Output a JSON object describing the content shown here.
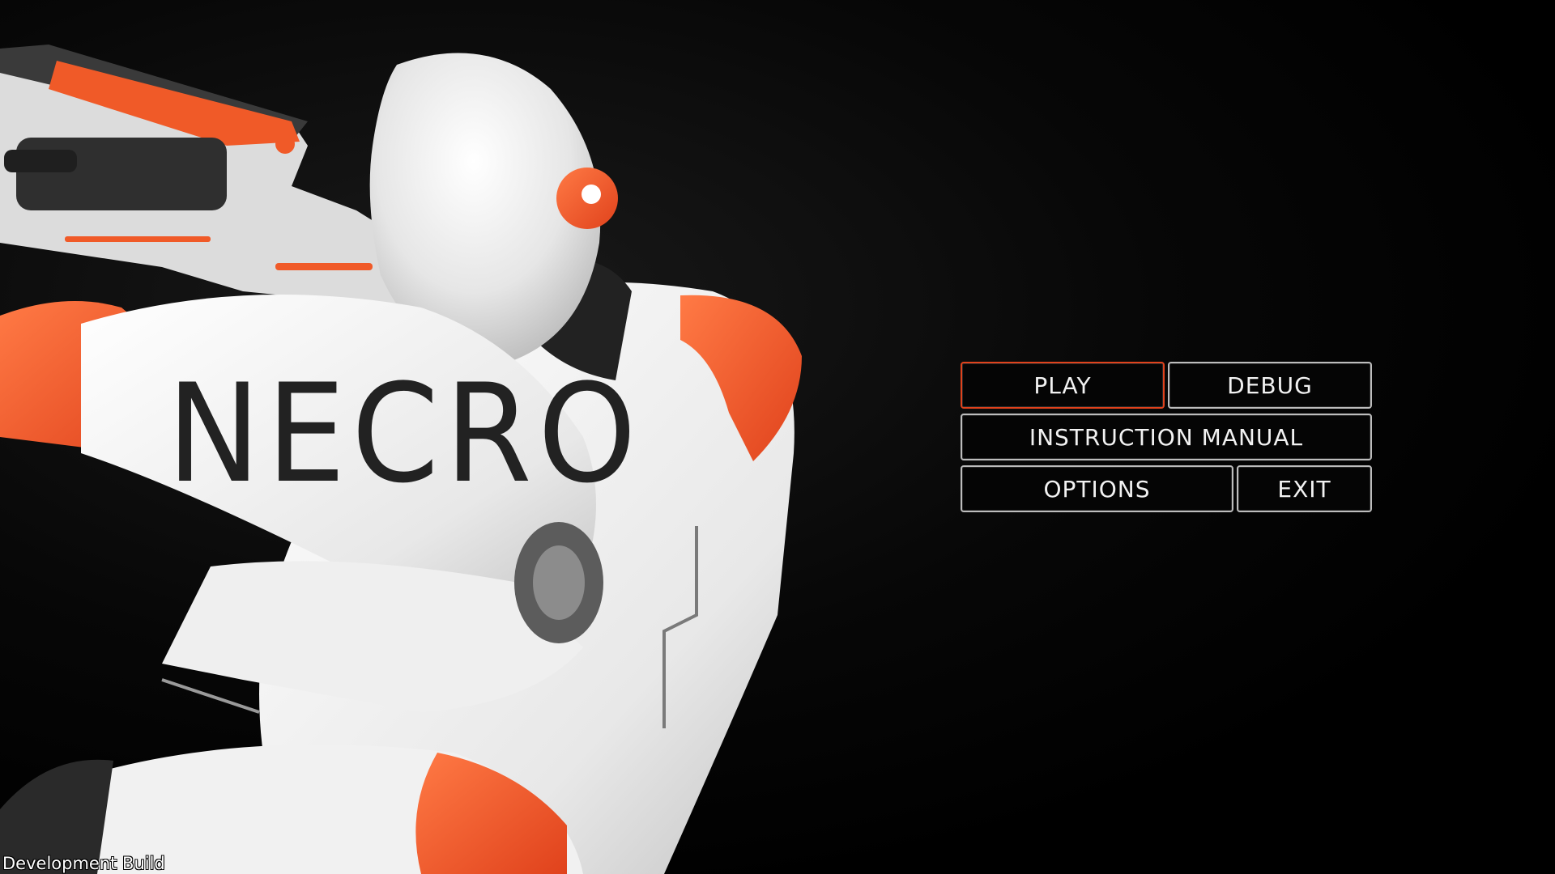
{
  "game": {
    "title": "NECRO"
  },
  "menu": {
    "play_label": "PLAY",
    "debug_label": "DEBUG",
    "manual_label": "INSTRUCTION MANUAL",
    "options_label": "OPTIONS",
    "exit_label": "EXIT",
    "selected": "play"
  },
  "footer": {
    "build_label": "Development Build"
  },
  "colors": {
    "accent": "#e0421c",
    "suit_orange": "#f05a28",
    "suit_white": "#f2f2f2",
    "background": "#000000"
  }
}
